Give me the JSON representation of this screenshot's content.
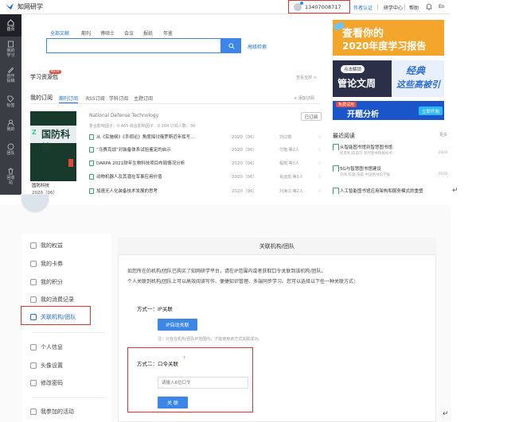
{
  "header": {
    "logo_text": "知网研学",
    "phone": "13407008717",
    "nav": [
      "作者认证",
      "研学中心",
      "帮助",
      "En"
    ]
  },
  "sidebar": {
    "items": [
      {
        "label": "首页",
        "icon": "home-icon"
      },
      {
        "label": "我的\n学习",
        "icon": "book-icon"
      },
      {
        "label": "创作\n投稿",
        "icon": "pen-icon"
      },
      {
        "label": "标签",
        "icon": "tag-icon"
      },
      {
        "label": "我的",
        "icon": "user-icon"
      },
      {
        "label": "团队",
        "icon": "team-icon"
      },
      {
        "label": "回收\n站",
        "icon": "trash-icon"
      }
    ]
  },
  "search": {
    "tabs": [
      "全部文献",
      "期刊",
      "博硕士",
      "会议",
      "报纸",
      "年鉴"
    ],
    "placeholder": "",
    "advanced": "高级检索"
  },
  "resources": {
    "title": "学习资源包",
    "badge": "NEW",
    "see_all": "查看全部 >",
    "subscription_title": "我的订阅",
    "subscription_tabs": [
      "期刊订阅",
      "RSS订阅",
      "学科订阅",
      "主题订阅"
    ],
    "add_subscription": "+ 添加订阅"
  },
  "magazine": {
    "cover_title": "国防科技",
    "name": "国防科技",
    "issue": "2020（06）",
    "english_name": "National Defense Technology",
    "stats": "复合影响因子：0.465    综合影响因子：0.284    订阅人数：30",
    "subscribed": "已订阅",
    "articles": [
      {
        "title": "从《实施纲》《手绸论》角度探讨俄罗斯近年挥写...",
        "year": "2020（06）",
        "author": "刘江楼"
      },
      {
        "title": "“马赛克战”对装备体系试验鉴定的启示",
        "year": "2020（06）",
        "author": "付隆;等2人"
      },
      {
        "title": "DARPA 2021财年生物科技项目布局情况分析",
        "year": "2020（06）",
        "author": "程晓;等3人"
      },
      {
        "title": "动物机器人及其潜在军事应用价值",
        "year": "2020（06）",
        "author": "肖远凯;等1人"
      },
      {
        "title": "加速无人化装备技术发展的思考",
        "year": "2020（06）",
        "author": "刘海江;等2人"
      }
    ]
  },
  "banners": {
    "b1_line1": "查看你的",
    "b1_line2": "2020年度学习报告",
    "b2_pill": "点击解锁",
    "b2_left": "管论文周",
    "b2_right1": "经典",
    "b2_right2": "这些高被引",
    "b3_free": "免费试用",
    "b3_title": "开题分析",
    "b3_button": "立即开始"
  },
  "recent": {
    "title": "最近阅读",
    "more": "更多",
    "items": [
      {
        "title": "从智能图书馆到智慧图书馆",
        "meta": "初景利;段美珍  现代图书情报技术",
        "year": "2020"
      },
      {
        "title": "5G与智慧图书馆建设",
        "meta": "刘炜;陈晨;张磊  中国图书馆学报",
        "year": "2020"
      },
      {
        "title": "人工智能图书馆应用架构和服务模式的重塑",
        "meta": "",
        "year": ""
      }
    ]
  },
  "account_menu": {
    "items": [
      {
        "label": "我的权益",
        "icon": "diamond-icon"
      },
      {
        "label": "我的卡券",
        "icon": "card-icon"
      },
      {
        "label": "我的积分",
        "icon": "points-icon"
      },
      {
        "label": "我的消费记录",
        "icon": "receipt-icon"
      },
      {
        "label": "关联机构/团队",
        "icon": "link-doc-icon"
      },
      {
        "label": "个人信息",
        "icon": "person-icon"
      },
      {
        "label": "头像设置",
        "icon": "avatar-icon"
      },
      {
        "label": "修改密码",
        "icon": "lock-icon"
      },
      {
        "label": "我参加的活动",
        "icon": "activity-icon"
      }
    ]
  },
  "link_org": {
    "heading": "关联机构/团队",
    "intro1": "如您所在的机构/团队已购买了知网研学平台，请在IP范围内或者获取口令关联到该机构/团队。",
    "intro2": "个人关联到机构/团队上可以高效阅读写作、便捷知识管理、多端同步学习。您可以选择以下任一种关联方式：",
    "method1_title": "方式一：IP关联",
    "ip_button": "IP自动关联",
    "ip_note": "注：只有在机构/团队IP范围内，才能使用该方式关联成功。",
    "method2_title": "方式二：口令关联",
    "help": "?",
    "code_placeholder": "请输入6位口令",
    "link_button": "关  联"
  },
  "return_mark": "↵",
  "colors": {
    "accent": "#3b86e6",
    "highlight": "#e23434",
    "sidebar": "#3a3d44"
  }
}
